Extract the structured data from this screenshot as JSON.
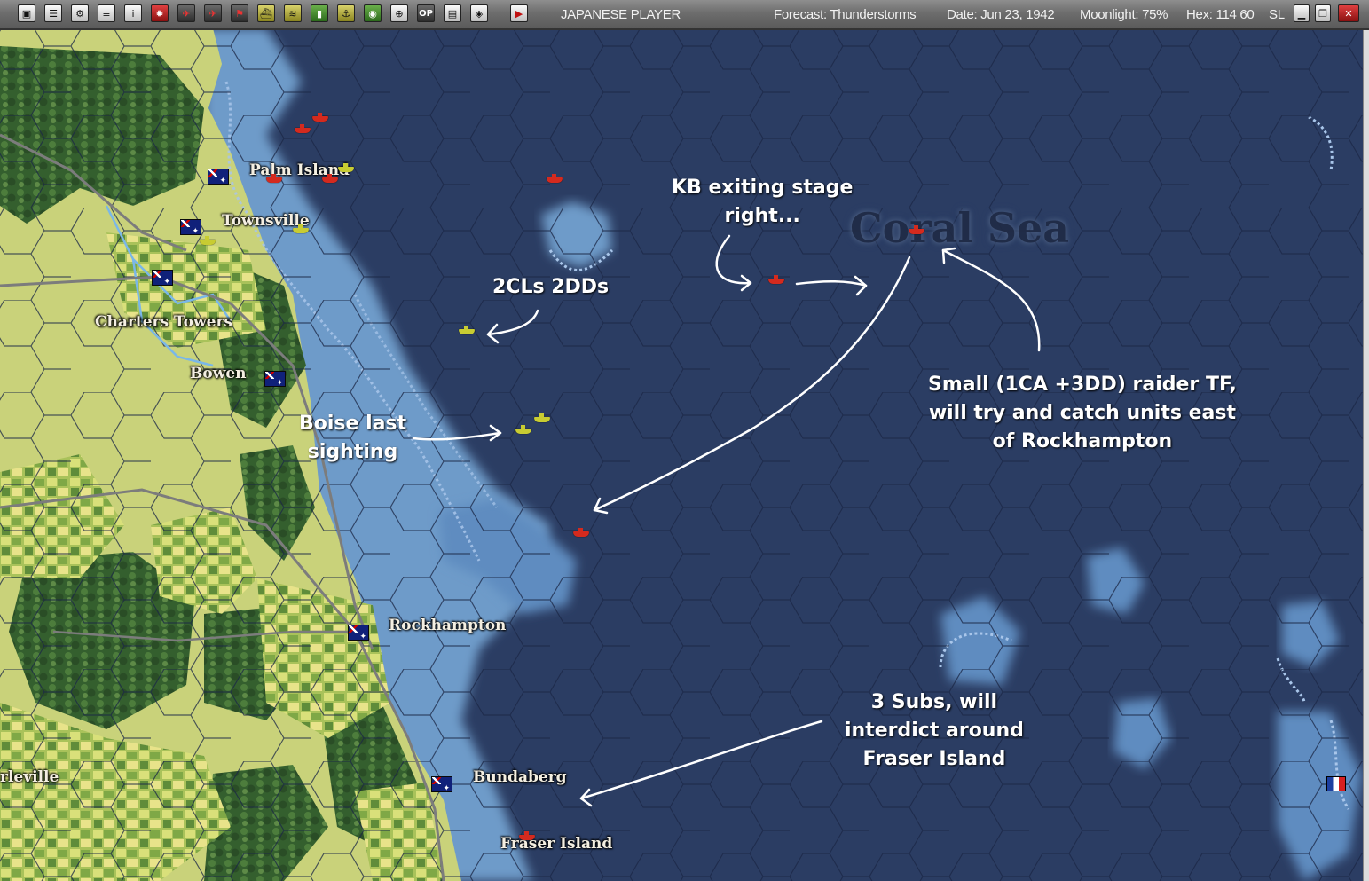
{
  "toolbar": {
    "buttons": [
      "save-icon",
      "document-icon",
      "group-icon",
      "list-icon",
      "info-icon",
      "rising-sun-icon",
      "air-icon",
      "aircraft-icon",
      "flag-icon",
      "ship-icon",
      "taskforce-icon",
      "chart-icon",
      "port-icon",
      "globe-icon",
      "target-icon",
      "op-icon",
      "report-icon",
      "intel-icon",
      "end-turn-icon"
    ],
    "op_label": "OP",
    "player": "JAPANESE PLAYER",
    "forecast": "Forecast: Thunderstorms",
    "date": "Date: Jun 23, 1942",
    "moonlight": "Moonlight: 75%",
    "hex": "Hex: 114 60",
    "sl_text": "SL",
    "window_buttons": [
      "minimize-icon",
      "restore-icon",
      "close-icon"
    ]
  },
  "map": {
    "sea_label": "Coral Sea",
    "places": [
      {
        "id": "palm-island",
        "label": "Palm Island"
      },
      {
        "id": "townsville",
        "label": "Townsville"
      },
      {
        "id": "charters-towers",
        "label": "Charters Towers"
      },
      {
        "id": "bowen",
        "label": "Bowen"
      },
      {
        "id": "rockhampton",
        "label": "Rockhampton"
      },
      {
        "id": "bundaberg",
        "label": "Bundaberg"
      },
      {
        "id": "fraser-island",
        "label": "Fraser Island"
      },
      {
        "id": "charleville",
        "label": "rleville"
      }
    ],
    "annotations": [
      {
        "id": "kb-exiting",
        "lines": [
          "KB exiting stage",
          "right..."
        ]
      },
      {
        "id": "cls-dds",
        "lines": [
          "2CLs 2DDs"
        ]
      },
      {
        "id": "boise",
        "lines": [
          "Boise last",
          "sighting"
        ]
      },
      {
        "id": "raider",
        "lines": [
          "Small (1CA +3DD) raider TF,",
          "will try and catch units east",
          "of Rockhampton"
        ]
      },
      {
        "id": "subs",
        "lines": [
          "3 Subs, will",
          "interdict around",
          "Fraser Island"
        ]
      }
    ],
    "colors": {
      "deep_ocean": "#2b3d63",
      "shallow": "#6e9bc9",
      "shallow_deep": "#4f7db0",
      "land_green": "#c9d27a",
      "forest": "#3f6b35",
      "japanese_unit": "#d42a1e",
      "allied_unit": "#c8cc32"
    }
  }
}
